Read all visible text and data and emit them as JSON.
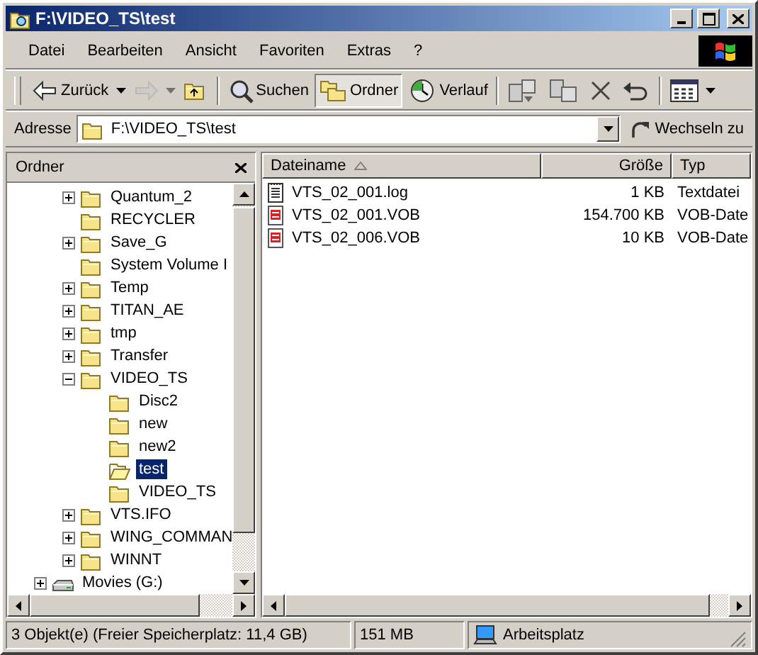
{
  "window": {
    "title": "F:\\VIDEO_TS\\test"
  },
  "menu": [
    {
      "label": "Datei"
    },
    {
      "label": "Bearbeiten"
    },
    {
      "label": "Ansicht"
    },
    {
      "label": "Favoriten"
    },
    {
      "label": "Extras"
    },
    {
      "label": "?"
    }
  ],
  "toolbar": [
    {
      "kind": "back",
      "label": "Zurück",
      "dropdown": true,
      "disabled": false,
      "pressed": false
    },
    {
      "kind": "forward",
      "dropdown": true,
      "disabled": true,
      "pressed": false
    },
    {
      "kind": "up",
      "dropdown": false,
      "disabled": false,
      "pressed": false
    },
    {
      "kind": "separator"
    },
    {
      "kind": "search",
      "label": "Suchen",
      "dropdown": false,
      "disabled": false,
      "pressed": false
    },
    {
      "kind": "folders",
      "label": "Ordner",
      "dropdown": false,
      "disabled": false,
      "pressed": true
    },
    {
      "kind": "history",
      "label": "Verlauf",
      "dropdown": false,
      "disabled": false,
      "pressed": false
    },
    {
      "kind": "separator"
    },
    {
      "kind": "move",
      "dropdown": false,
      "disabled": false,
      "pressed": false
    },
    {
      "kind": "copy",
      "dropdown": false,
      "disabled": false,
      "pressed": false
    },
    {
      "kind": "delete",
      "dropdown": false,
      "disabled": false,
      "pressed": false
    },
    {
      "kind": "undo",
      "dropdown": false,
      "disabled": false,
      "pressed": false
    },
    {
      "kind": "separator"
    },
    {
      "kind": "views",
      "dropdown": true,
      "disabled": false,
      "pressed": false
    }
  ],
  "address": {
    "label": "Adresse",
    "value": "F:\\VIDEO_TS\\test",
    "go": "Wechseln zu"
  },
  "tree": {
    "title": "Ordner",
    "items": [
      {
        "children": [
          {
            "label": "Quantum_2",
            "kind": "folder",
            "expanded": false,
            "selected": false
          },
          {
            "label": "RECYCLER",
            "kind": "folder",
            "selected": false
          },
          {
            "label": "Save_G",
            "kind": "folder",
            "expanded": false,
            "selected": false
          },
          {
            "label": "System Volume I",
            "kind": "folder",
            "selected": false
          },
          {
            "label": "Temp",
            "kind": "folder",
            "expanded": false,
            "selected": false
          },
          {
            "label": "TITAN_AE",
            "kind": "folder",
            "expanded": false,
            "selected": false
          },
          {
            "label": "tmp",
            "kind": "folder",
            "expanded": false,
            "selected": false
          },
          {
            "label": "Transfer",
            "kind": "folder",
            "expanded": false,
            "selected": false
          },
          {
            "label": "VIDEO_TS",
            "kind": "folder",
            "expanded": true,
            "selected": false,
            "children": [
              {
                "label": "Disc2",
                "kind": "folder",
                "selected": false
              },
              {
                "label": "new",
                "kind": "folder",
                "selected": false
              },
              {
                "label": "new2",
                "kind": "folder",
                "selected": false
              },
              {
                "label": "test",
                "kind": "folder",
                "selected": true
              },
              {
                "label": "VIDEO_TS",
                "kind": "folder",
                "selected": false
              }
            ]
          },
          {
            "label": "VTS.IFO",
            "kind": "folder",
            "expanded": false,
            "selected": false
          },
          {
            "label": "WING_COMMAN",
            "kind": "folder",
            "expanded": false,
            "selected": false
          },
          {
            "label": "WINNT",
            "kind": "folder",
            "expanded": false,
            "selected": false
          }
        ]
      },
      {
        "label": "Movies (G:)",
        "kind": "drive",
        "expanded": false,
        "selected": false
      }
    ]
  },
  "files": {
    "columns": [
      {
        "label": "Dateiname",
        "sorted": true
      },
      {
        "label": "Größe",
        "sorted": false
      },
      {
        "label": "Typ",
        "sorted": false
      }
    ],
    "rows": [
      {
        "kind": "text",
        "name": "VTS_02_001.log",
        "size": "1 KB",
        "type": "Textdatei",
        "selected": false
      },
      {
        "kind": "video",
        "name": "VTS_02_001.VOB",
        "size": "154.700 KB",
        "type": "VOB-Date",
        "selected": false
      },
      {
        "kind": "video",
        "name": "VTS_02_006.VOB",
        "size": "10 KB",
        "type": "VOB-Date",
        "selected": false
      }
    ]
  },
  "status_bar": {
    "objects": "3 Objekt(e) (Freier Speicherplatz: 11,4 GB)",
    "size": "151 MB",
    "location": "Arbeitsplatz"
  }
}
